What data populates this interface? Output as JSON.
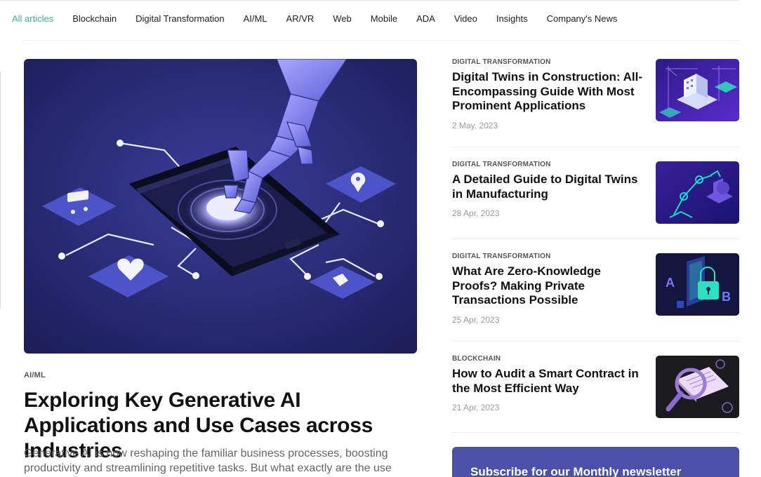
{
  "nav": {
    "items": [
      {
        "label": "All articles",
        "active": true
      },
      {
        "label": "Blockchain",
        "active": false
      },
      {
        "label": "Digital Transformation",
        "active": false
      },
      {
        "label": "AI/ML",
        "active": false
      },
      {
        "label": "AR/VR",
        "active": false
      },
      {
        "label": "Web",
        "active": false
      },
      {
        "label": "Mobile",
        "active": false
      },
      {
        "label": "ADA",
        "active": false
      },
      {
        "label": "Video",
        "active": false
      },
      {
        "label": "Insights",
        "active": false
      },
      {
        "label": "Company's News",
        "active": false
      }
    ]
  },
  "featured": {
    "category": "AI/ML",
    "title": "Exploring Key Generative AI Applications and Use Cases across Industries",
    "excerpt": "Generative AI is now reshaping the familiar business processes, boosting productivity and streamlining repetitive tasks. But what exactly are the use cases"
  },
  "articles": [
    {
      "category": "DIGITAL TRANSFORMATION",
      "title": "Digital Twins in Construction: All-Encompassing Guide With Most Prominent Applications",
      "date": "2 May, 2023",
      "thumb_icon": "construction-crane-illustration"
    },
    {
      "category": "DIGITAL TRANSFORMATION",
      "title": "A Detailed Guide to Digital Twins in Manufacturing",
      "date": "28 Apr, 2023",
      "thumb_icon": "robotic-arm-illustration"
    },
    {
      "category": "DIGITAL TRANSFORMATION",
      "title": "What Are Zero-Knowledge Proofs? Making Private Transactions Possible",
      "date": "25 Apr, 2023",
      "thumb_icon": "padlock-illustration"
    },
    {
      "category": "BLOCKCHAIN",
      "title": "How to Audit a Smart Contract in the Most Efficient Way",
      "date": "21 Apr, 2023",
      "thumb_icon": "smart-contract-magnifier-illustration"
    }
  ],
  "newsletter": {
    "title": "Subscribe for our Monthly newsletter"
  },
  "colors": {
    "accent": "#3fb28f",
    "newsletter_bg": "#4b51a8",
    "hero_bg": "#2a2c7a"
  }
}
